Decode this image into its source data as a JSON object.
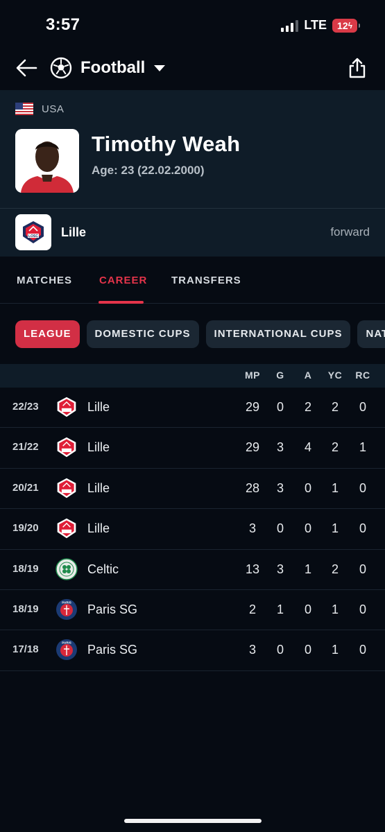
{
  "status": {
    "time": "3:57",
    "network": "LTE",
    "battery": "12"
  },
  "nav": {
    "sport": "Football",
    "back_icon": "arrow-left-icon",
    "sport_icon": "soccer-ball-icon",
    "dropdown_icon": "caret-down-icon",
    "share_icon": "share-icon"
  },
  "player": {
    "country": "USA",
    "name": "Timothy Weah",
    "age": "Age: 23 (22.02.2000)",
    "team": "Lille",
    "position": "forward"
  },
  "tabs": [
    "MATCHES",
    "CAREER",
    "TRANSFERS"
  ],
  "active_tab": "CAREER",
  "chips": [
    "LEAGUE",
    "DOMESTIC CUPS",
    "INTERNATIONAL CUPS",
    "NATI"
  ],
  "active_chip": "LEAGUE",
  "table": {
    "columns": [
      "MP",
      "G",
      "A",
      "YC",
      "RC"
    ],
    "rows": [
      {
        "season": "22/23",
        "club": "Lille",
        "stats": [
          "29",
          "0",
          "2",
          "2",
          "0"
        ]
      },
      {
        "season": "21/22",
        "club": "Lille",
        "stats": [
          "29",
          "3",
          "4",
          "2",
          "1"
        ]
      },
      {
        "season": "20/21",
        "club": "Lille",
        "stats": [
          "28",
          "3",
          "0",
          "1",
          "0"
        ]
      },
      {
        "season": "19/20",
        "club": "Lille",
        "stats": [
          "3",
          "0",
          "0",
          "1",
          "0"
        ]
      },
      {
        "season": "18/19",
        "club": "Celtic",
        "stats": [
          "13",
          "3",
          "1",
          "2",
          "0"
        ]
      },
      {
        "season": "18/19",
        "club": "Paris SG",
        "stats": [
          "2",
          "1",
          "0",
          "1",
          "0"
        ]
      },
      {
        "season": "17/18",
        "club": "Paris SG",
        "stats": [
          "3",
          "0",
          "0",
          "1",
          "0"
        ]
      }
    ]
  },
  "logo_text": {
    "lille": "LOSC",
    "psg": "PARIS"
  },
  "colors": {
    "accent": "#e4344a",
    "background": "#060b13",
    "header": "#0f1c28",
    "chip": "#1b2733"
  }
}
